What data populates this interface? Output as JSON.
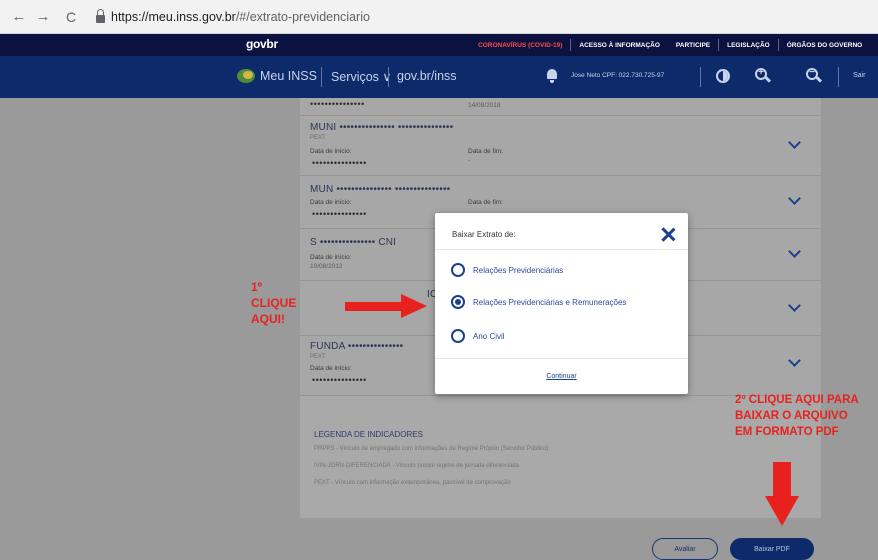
{
  "browser": {
    "back": "←",
    "forward": "→",
    "reload": "C",
    "url_host": "https://meu.inss.gov.br",
    "url_path": "/#/extrato-previdenciario"
  },
  "govbar": {
    "logo": "govbr",
    "covid": "CORONAVÍRUS (COVID-19)",
    "acesso": "ACESSO À INFORMAÇÃO",
    "participe": "PARTICIPE",
    "legislacao": "LEGISLAÇÃO",
    "orgaos": "ÓRGÃOS DO GOVERNO"
  },
  "header": {
    "brand": "Meu INSS",
    "servicos": "Serviços ∨",
    "govbr_inss": "gov.br/inss",
    "user": "Jose Neto CPF: 022.730.725-97",
    "zoom_in": "+",
    "zoom_out": "−",
    "sair": "Sair"
  },
  "records": [
    {
      "masked": "•••••••••••••••",
      "date": "14/08/2018"
    },
    {
      "title": "MUNI ••••••••••••••• •••••••••••••••",
      "tag": "PEXT",
      "start_label": "Data de início:",
      "start_value": "•••••••••••••••",
      "end_label": "Data de fim:",
      "end_value": "-"
    },
    {
      "title": "MUN ••••••••••••••• •••••••••••••••",
      "start_label": "Data de início:",
      "start_value": "•••••••••••••••",
      "end_label": "Data de fim:"
    },
    {
      "title": "S ••••••••••••••• CNI",
      "start_label": "Data de início:",
      "start_value": "10/08/2012"
    },
    {
      "title": "IO"
    },
    {
      "title": "FUNDA •••••••••••••••",
      "tag": "PEXT",
      "start_label": "Data de início:",
      "start_value": "•••••••••••••••"
    }
  ],
  "legend": {
    "title": "LEGENDA DE INDICADORES",
    "items": [
      "PRPPS - Vínculo de empregado com informações de Regime Próprio (Servidor Público)",
      "IVIN-JORN-DIFERENCIADA - Vínculo possui regime de jornada diferenciada",
      "PEXT - Vínculo com informação extemporânea, passível de comprovação"
    ]
  },
  "buttons": {
    "avaliar": "Avaliar",
    "baixar_pdf": "Baixar PDF"
  },
  "modal": {
    "title": "Baixar Extrato de:",
    "options": [
      {
        "label": "Relações Previdenciárias",
        "checked": false
      },
      {
        "label": "Relações Previdenciárias e Remunerações",
        "checked": true
      },
      {
        "label": "Ano Civil",
        "checked": false
      }
    ],
    "continue": "Continuar"
  },
  "annotations": {
    "first_l1": "1º",
    "first_l2": "CLIQUE",
    "first_l3": "AQUI!",
    "second_l1": "2º CLIQUE AQUI PARA",
    "second_l2": "BAIXAR O ARQUIVO",
    "second_l3": "EM FORMATO PDF",
    "color": "#e8211f"
  },
  "colors": {
    "govbar": "#0b1240",
    "header": "#0d2a6b",
    "accent": "#1c3f8c"
  }
}
